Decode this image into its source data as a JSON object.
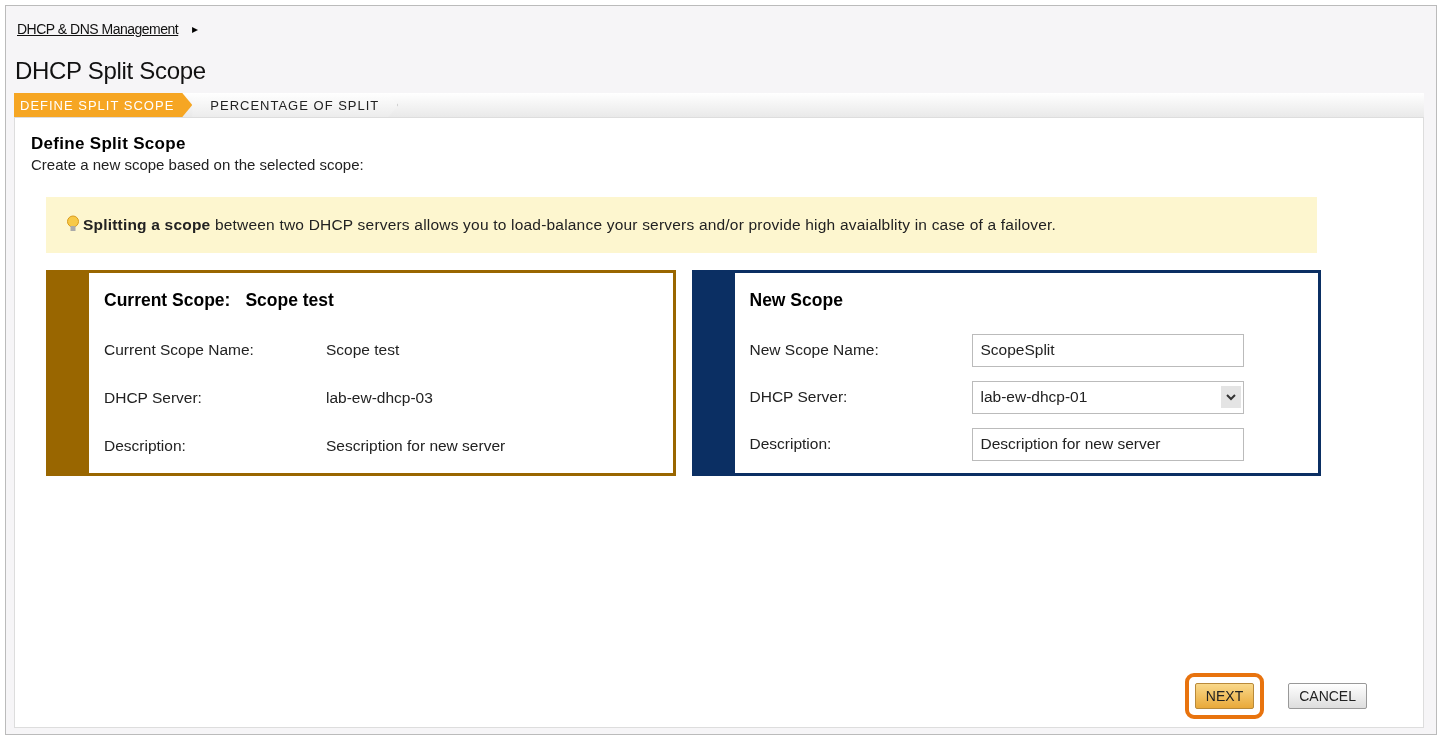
{
  "breadcrumb": {
    "label": "DHCP & DNS Management",
    "arrow": "▸"
  },
  "title": "DHCP Split Scope",
  "steps": [
    {
      "label": "DEFINE SPLIT SCOPE",
      "selected": true
    },
    {
      "label": "PERCENTAGE OF SPLIT",
      "selected": false
    }
  ],
  "section": {
    "heading": "Define Split Scope",
    "subtitle": "Create a new scope based on the selected scope:"
  },
  "tip": "**Splitting a scope** between two DHCP servers allows you to load-balance your servers and/or provide high avaialblity in case of a failover.",
  "panels": [
    {
      "heading": "Current Scope:",
      "heading_value": "Scope test",
      "color": "#996600",
      "rows": [
        {
          "kind": "text",
          "label": "Current Scope Name:",
          "value": "Scope test"
        },
        {
          "kind": "text",
          "label": "DHCP Server:",
          "value": "lab-ew-dhcp-03"
        },
        {
          "kind": "text",
          "label": "Description:",
          "value": "Sescription for new server"
        }
      ]
    },
    {
      "heading": "New Scope",
      "color": "#0b2f63",
      "rows": [
        {
          "kind": "input",
          "label": "New Scope Name:",
          "value": "ScopeSplit"
        },
        {
          "kind": "select",
          "label": "DHCP Server:",
          "value": "lab-ew-dhcp-01"
        },
        {
          "kind": "input",
          "label": "Description:",
          "value": "Description for new server"
        }
      ]
    }
  ],
  "buttons": [
    {
      "label": "NEXT",
      "kind": "primary",
      "highlighted": true
    },
    {
      "label": "CANCEL",
      "kind": "secondary",
      "highlighted": false
    }
  ]
}
